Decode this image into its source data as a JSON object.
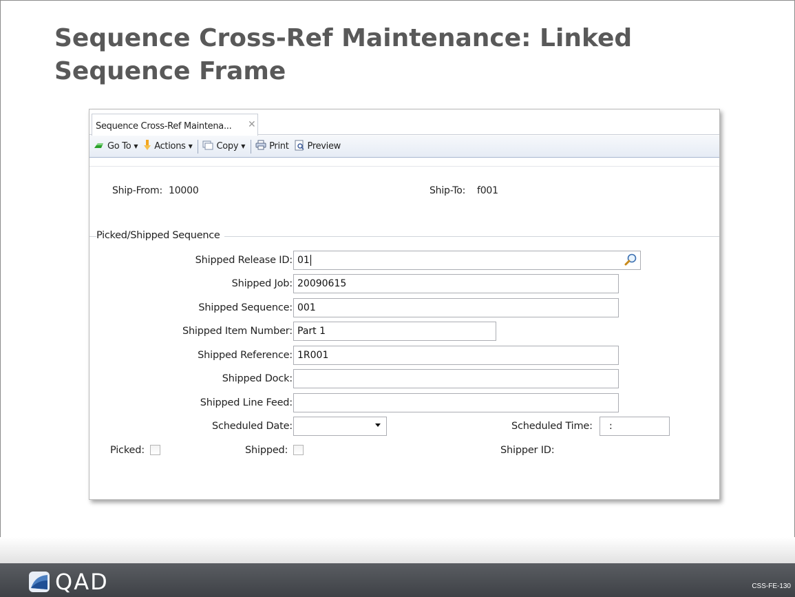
{
  "slide": {
    "title": "Sequence Cross-Ref Maintenance: Linked Sequence Frame",
    "footer_logo": "QAD",
    "slide_code": "CSS-FE-130"
  },
  "window": {
    "tab_label": "Sequence Cross-Ref Maintena...",
    "toolbar": {
      "goto_label": "Go To",
      "actions_label": "Actions",
      "copy_label": "Copy",
      "print_label": "Print",
      "preview_label": "Preview"
    },
    "header": {
      "ship_from_label": "Ship-From:",
      "ship_from_value": "10000",
      "ship_to_label": "Ship-To:",
      "ship_to_value": "f001"
    },
    "section_title": "Picked/Shipped Sequence",
    "fields": {
      "release_id": {
        "label": "Shipped Release ID:",
        "value": "01"
      },
      "job": {
        "label": "Shipped Job:",
        "value": "20090615"
      },
      "sequence": {
        "label": "Shipped Sequence:",
        "value": "001"
      },
      "item_number": {
        "label": "Shipped Item Number:",
        "value": "Part 1"
      },
      "reference": {
        "label": "Shipped Reference:",
        "value": "1R001"
      },
      "dock": {
        "label": "Shipped Dock:",
        "value": ""
      },
      "line_feed": {
        "label": "Shipped Line Feed:",
        "value": ""
      },
      "scheduled_date": {
        "label": "Scheduled Date:",
        "value": ""
      },
      "scheduled_time": {
        "label": "Scheduled Time:",
        "value": ":"
      }
    },
    "checks": {
      "picked_label": "Picked:",
      "picked_checked": false,
      "shipped_label": "Shipped:",
      "shipped_checked": false,
      "shipper_id_label": "Shipper ID:"
    }
  }
}
